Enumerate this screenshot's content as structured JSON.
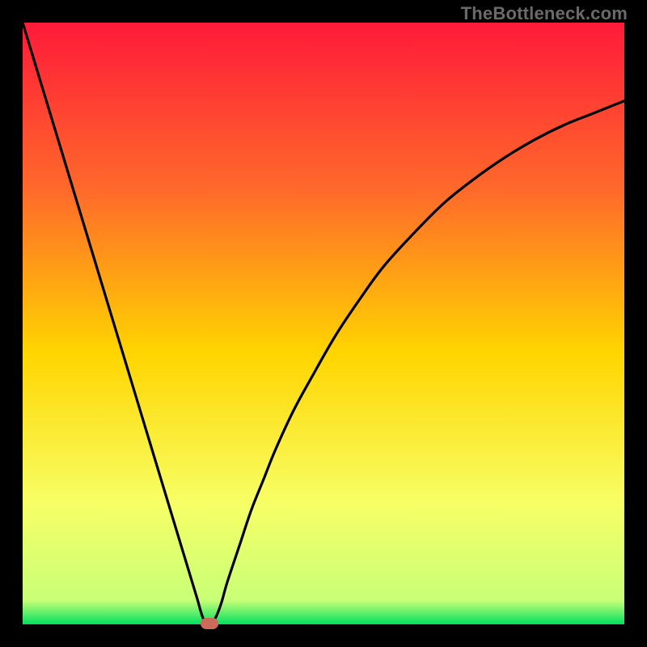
{
  "attribution": "TheBottleneck.com",
  "colors": {
    "bg_black": "#000000",
    "gradient_top": "#ff1a3a",
    "gradient_mid1": "#ff6a2a",
    "gradient_mid2": "#ffd500",
    "gradient_mid3": "#f7ff66",
    "gradient_bottom": "#00e060",
    "curve": "#000000",
    "marker": "#cc6b5a",
    "attribution_text": "#6a6a6a"
  },
  "chart_data": {
    "type": "line",
    "title": "",
    "xlabel": "",
    "ylabel": "",
    "xlim": [
      0,
      100
    ],
    "ylim": [
      0,
      100
    ],
    "grid": false,
    "legend": false,
    "x": [
      0,
      2,
      4,
      6,
      8,
      10,
      12,
      14,
      16,
      18,
      20,
      22,
      24,
      26,
      27,
      28,
      29,
      30,
      31,
      32,
      33,
      34,
      36,
      38,
      40,
      42,
      45,
      48,
      52,
      56,
      60,
      65,
      70,
      75,
      80,
      85,
      90,
      95,
      100
    ],
    "values": [
      100,
      93.4,
      86.8,
      80.2,
      73.6,
      67,
      60.4,
      53.8,
      47.2,
      40.6,
      34,
      27.4,
      20.8,
      14.2,
      10.9,
      7.6,
      4.3,
      1,
      0,
      1,
      3.5,
      7,
      13,
      19,
      24,
      29,
      35.5,
      41,
      48,
      54,
      59.5,
      65,
      70,
      74,
      77.5,
      80.5,
      83,
      85,
      87
    ],
    "marker": {
      "x": 31,
      "y": 0
    },
    "notes": "V-shaped bottleneck curve over vertical red→yellow→green gradient. Values are visual estimates from the plot (no axis ticks shown)."
  }
}
